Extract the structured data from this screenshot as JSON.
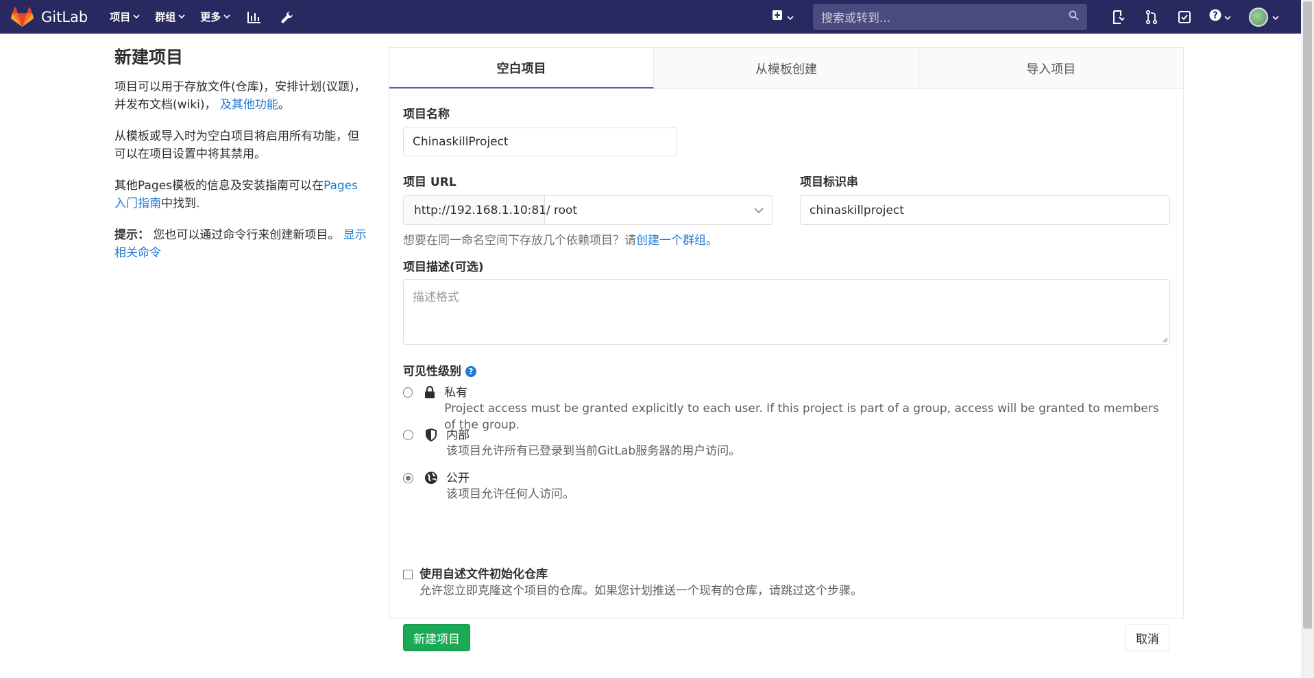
{
  "navbar": {
    "brand": "GitLab",
    "menu": [
      {
        "label": "项目"
      },
      {
        "label": "群组"
      },
      {
        "label": "更多"
      }
    ],
    "search_placeholder": "搜索或转到..."
  },
  "sidebar": {
    "title": "新建项目",
    "p1_text": "项目可以用于存放文件(仓库)，安排计划(议题)，并发布文档(wiki)，",
    "p1_link": "及其他功能",
    "p1_end": "。",
    "p2_text": "从模板或导入时为空白项目将启用所有功能，但可以在项目设置中将其禁用。",
    "p3_text": "其他Pages模板的信息及安装指南可以在",
    "p3_link": "Pages入门指南",
    "p3_end": "中找到.",
    "p4_bold": "提示：",
    "p4_text": " 您也可以通过命令行来创建新项目。",
    "p4_link": "显示相关命令"
  },
  "tabs": [
    {
      "label": "空白项目",
      "active": true
    },
    {
      "label": "从模板创建",
      "active": false
    },
    {
      "label": "导入项目",
      "active": false
    }
  ],
  "form": {
    "name_label": "项目名称",
    "name_value": "ChinaskillProject",
    "url_label": "项目 URL",
    "url_prefix": "http://192.168.1.10:81/",
    "url_namespace": "root",
    "slug_label": "项目标识串",
    "slug_value": "chinaskillproject",
    "help_text": "想要在同一命名空间下存放几个依赖项目？请",
    "help_link": "创建一个群组。",
    "desc_label": "项目描述(可选)",
    "desc_placeholder": "描述格式",
    "visibility_label": "可见性级别",
    "visibility_options": [
      {
        "title": "私有",
        "desc": "Project access must be granted explicitly to each user. If this project is part of a group, access will be granted to members of the group.",
        "checked": false
      },
      {
        "title": "内部",
        "desc": "该项目允许所有已登录到当前GitLab服务器的用户访问。",
        "checked": false
      },
      {
        "title": "公开",
        "desc": "该项目允许任何人访问。",
        "checked": true
      }
    ],
    "readme_label": "使用自述文件初始化仓库",
    "readme_desc": "允许您立即克隆这个项目的仓库。如果您计划推送一个现有的仓库，请跳过这个步骤。",
    "readme_checked": false,
    "submit_label": "新建项目",
    "cancel_label": "取消"
  },
  "colors": {
    "navbar": "#292961",
    "accent": "#1aaa55",
    "link": "#1f78d1"
  }
}
